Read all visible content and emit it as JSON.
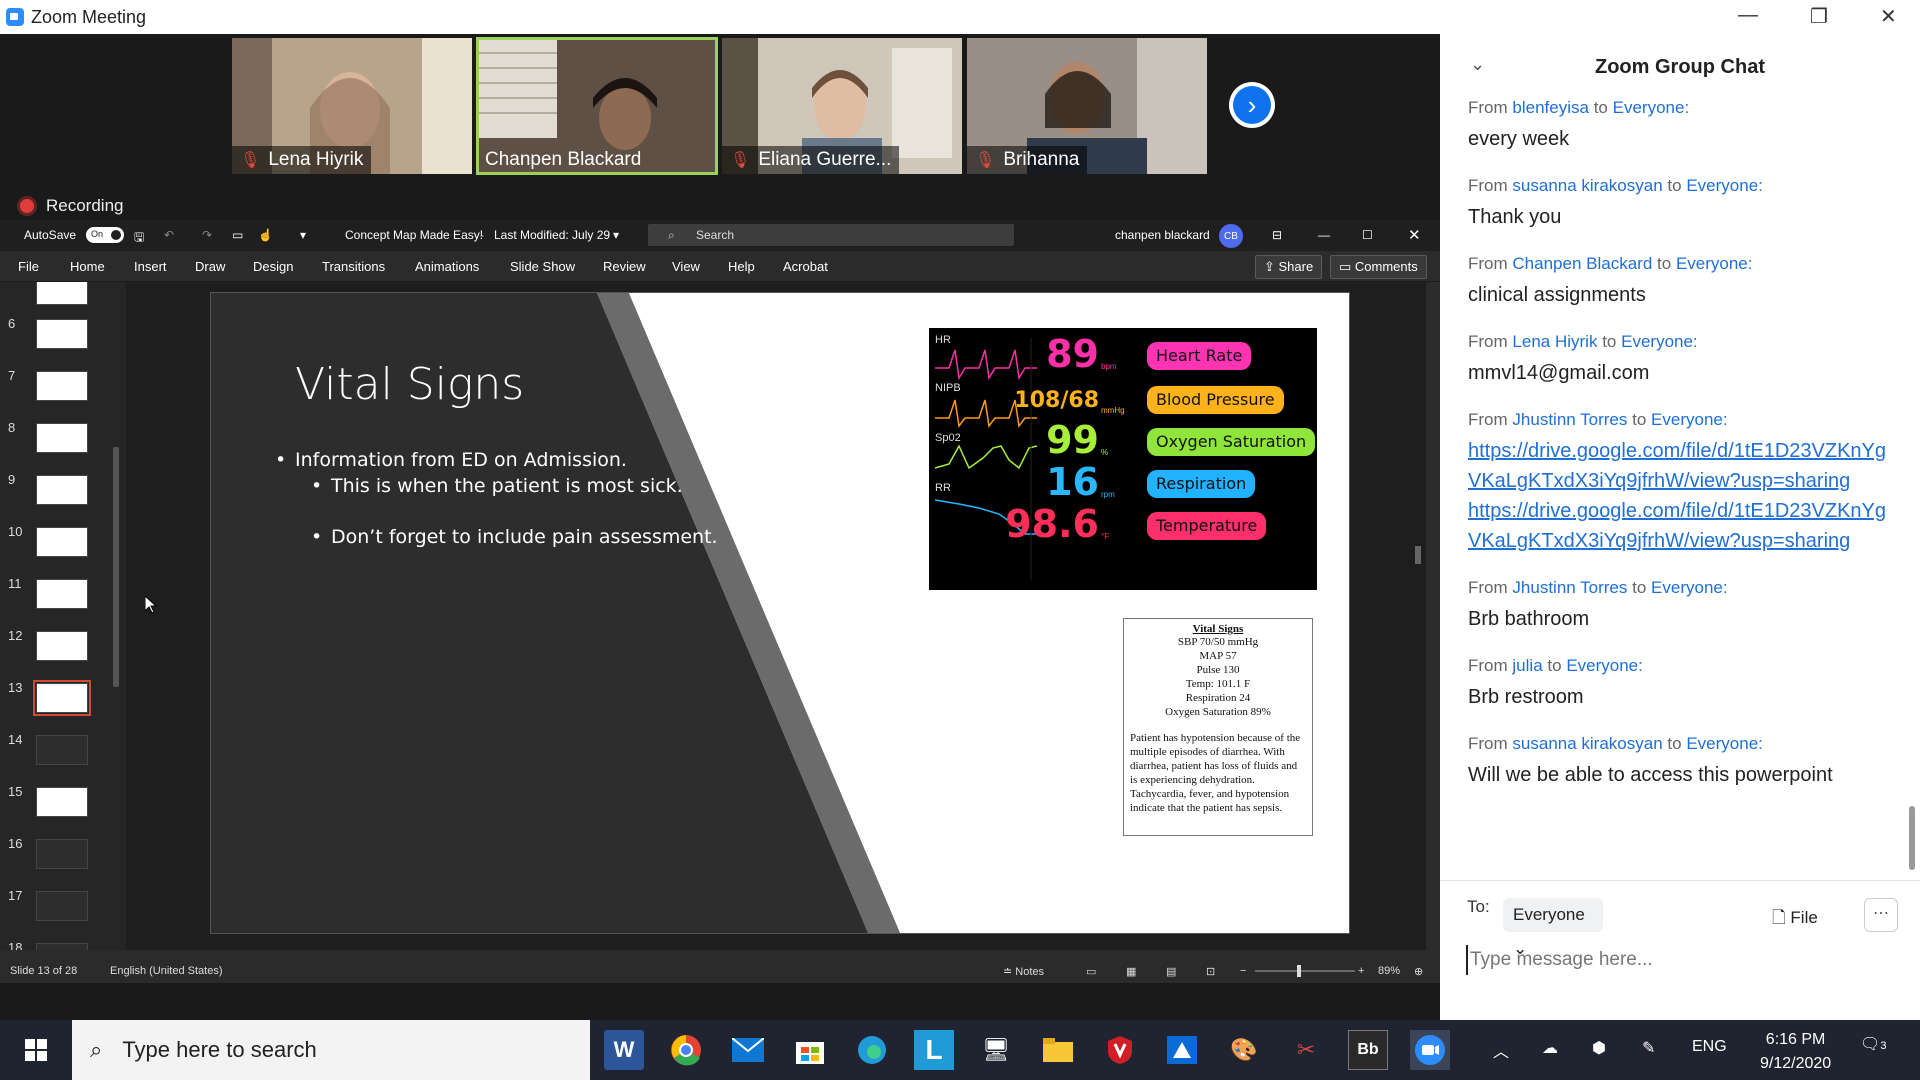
{
  "window": {
    "title": "Zoom Meeting"
  },
  "participants": [
    {
      "name": "Lena Hiyrik",
      "muted": true,
      "bg": "#b9a48c"
    },
    {
      "name": "Chanpen Blackard",
      "muted": false,
      "bg": "#6e6256"
    },
    {
      "name": "Eliana Guerre...",
      "muted": true,
      "bg": "#c9c2b3"
    },
    {
      "name": "Brihanna",
      "muted": true,
      "bg": "#9b8f85"
    }
  ],
  "recording": {
    "label": "Recording"
  },
  "ppt": {
    "autosave": "AutoSave",
    "autosave_state": "On",
    "doc_title": "Concept Map Made Easy!",
    "modified": "Last Modified: July 29",
    "search_placeholder": "Search",
    "user": "chanpen blackard",
    "user_initials": "CB",
    "tabs": [
      "File",
      "Home",
      "Insert",
      "Draw",
      "Design",
      "Transitions",
      "Animations",
      "Slide Show",
      "Review",
      "View",
      "Help",
      "Acrobat"
    ],
    "share": "Share",
    "comments": "Comments",
    "thumbnails": [
      "6",
      "7",
      "8",
      "9",
      "10",
      "11",
      "12",
      "13",
      "14",
      "15",
      "16",
      "17",
      "18"
    ],
    "selected_slide": "13",
    "slide": {
      "title": "Vital Signs",
      "bullet1": "Information from ED on Admission.",
      "bullet2": "This is when the patient is most sick.",
      "bullet3": "Don’t forget to include pain assessment."
    },
    "monitor": {
      "labels": [
        "HR",
        "NIPB",
        "Sp02",
        "RR"
      ],
      "rows": [
        {
          "value": "89",
          "unit": "bpm",
          "label": "Heart Rate",
          "color": "#ff2fa8",
          "pill": "#ff34b3"
        },
        {
          "value": "108/68",
          "unit": "mmHg",
          "label": "Blood Pressure",
          "color": "#ffb21a",
          "pill": "#ffb21a"
        },
        {
          "value": "99",
          "unit": "%",
          "label": "Oxygen Saturation",
          "color": "#a8ef3a",
          "pill": "#8fe53a"
        },
        {
          "value": "16",
          "unit": "rpm",
          "label": "Respiration",
          "color": "#2ab7ff",
          "pill": "#22b2ff"
        },
        {
          "value": "98.6",
          "unit": "°F",
          "label": "Temperature",
          "color": "#ff2f5a",
          "pill": "#ff2f6b"
        }
      ]
    },
    "vs_box": {
      "heading": "Vital Signs",
      "lines": [
        "SBP 70/50 mmHg",
        "MAP 57",
        "Pulse 130",
        "Temp: 101.1 F",
        "Respiration 24",
        "Oxygen Saturation 89%"
      ],
      "paragraph": "Patient has hypotension because of the multiple episodes of diarrhea. With diarrhea, patient has loss of fluids and is experiencing dehydration.  Tachycardia, fever, and hypotension indicate that the patient has sepsis."
    },
    "status": {
      "slide": "Slide 13 of 28",
      "language": "English (United States)",
      "notes": "Notes",
      "zoom": "89%"
    }
  },
  "chat": {
    "title": "Zoom Group Chat",
    "messages": [
      {
        "from": "blenfeyisa",
        "to": "Everyone:",
        "text": "every week"
      },
      {
        "from": "susanna kirakosyan",
        "to": "Everyone:",
        "text": "Thank you"
      },
      {
        "from": "Chanpen Blackard",
        "to": "Everyone:",
        "text": "clinical assignments"
      },
      {
        "from": "Lena Hiyrik",
        "to": "Everyone:",
        "text": "mmvl14@gmail.com"
      },
      {
        "from": "Jhustinn Torres",
        "to": "Everyone:",
        "links": [
          "https://drive.google.com/file/d/1tE1D23VZKnYgVKaLgKTxdX3iYq9jfrhW/view?usp=sharing",
          "https://drive.google.com/file/d/1tE1D23VZKnYgVKaLgKTxdX3iYq9jfrhW/view?usp=sharing"
        ]
      },
      {
        "from": "Jhustinn Torres",
        "to": "Everyone:",
        "text": "Brb bathroom"
      },
      {
        "from": "julia",
        "to": "Everyone:",
        "text": "Brb restroom"
      },
      {
        "from": "susanna kirakosyan",
        "to": "Everyone:",
        "text": "Will we be able to access this powerpoint"
      }
    ],
    "from_word": "From",
    "to_word": "to",
    "to_label": "To:",
    "recipient": "Everyone",
    "file_label": "File",
    "input_placeholder": "Type message here..."
  },
  "taskbar": {
    "search_placeholder": "Type here to search",
    "lang": "ENG",
    "time": "6:16 PM",
    "date": "9/12/2020",
    "notif_count": "3"
  }
}
